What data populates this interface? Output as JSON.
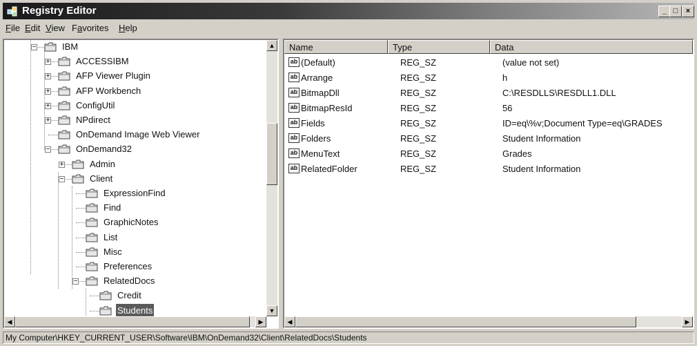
{
  "window": {
    "title": "Registry Editor"
  },
  "menu": [
    "File",
    "Edit",
    "View",
    "Favorites",
    "Help"
  ],
  "menu_underline": [
    "F",
    "E",
    "V",
    "a",
    "H"
  ],
  "tree": [
    {
      "label": "IBM",
      "expander": "−"
    },
    {
      "label": "ACCESSIBM",
      "expander": "+"
    },
    {
      "label": "AFP Viewer Plugin",
      "expander": "+"
    },
    {
      "label": "AFP Workbench",
      "expander": "+"
    },
    {
      "label": "ConfigUtil",
      "expander": "+"
    },
    {
      "label": "NPdirect",
      "expander": "+"
    },
    {
      "label": "OnDemand Image Web Viewer",
      "expander": ""
    },
    {
      "label": "OnDemand32",
      "expander": "−"
    },
    {
      "label": "Admin",
      "expander": "+"
    },
    {
      "label": "Client",
      "expander": "−"
    },
    {
      "label": "ExpressionFind",
      "expander": ""
    },
    {
      "label": "Find",
      "expander": ""
    },
    {
      "label": "GraphicNotes",
      "expander": ""
    },
    {
      "label": "List",
      "expander": ""
    },
    {
      "label": "Misc",
      "expander": ""
    },
    {
      "label": "Preferences",
      "expander": ""
    },
    {
      "label": "RelatedDocs",
      "expander": "−"
    },
    {
      "label": "Credit",
      "expander": ""
    },
    {
      "label": "Students",
      "expander": ""
    }
  ],
  "list": {
    "columns": [
      "Name",
      "Type",
      "Data"
    ],
    "rows": [
      {
        "icon": "ab",
        "name": "(Default)",
        "type": "REG_SZ",
        "data": "(value not set)"
      },
      {
        "icon": "ab",
        "name": "Arrange",
        "type": "REG_SZ",
        "data": "h"
      },
      {
        "icon": "ab",
        "name": "BitmapDll",
        "type": "REG_SZ",
        "data": "C:\\RESDLLS\\RESDLL1.DLL"
      },
      {
        "icon": "ab",
        "name": "BitmapResId",
        "type": "REG_SZ",
        "data": "56"
      },
      {
        "icon": "ab",
        "name": "Fields",
        "type": "REG_SZ",
        "data": "ID=eq\\%v;Document Type=eq\\GRADES"
      },
      {
        "icon": "ab",
        "name": "Folders",
        "type": "REG_SZ",
        "data": "Student Information"
      },
      {
        "icon": "ab",
        "name": "MenuText",
        "type": "REG_SZ",
        "data": "Grades"
      },
      {
        "icon": "ab",
        "name": "RelatedFolder",
        "type": "REG_SZ",
        "data": "Student Information"
      }
    ]
  },
  "status": "My Computer\\HKEY_CURRENT_USER\\Software\\IBM\\OnDemand32\\Client\\RelatedDocs\\Students",
  "caption_buttons": {
    "minimize": "_",
    "maximize": "□",
    "close": "×"
  },
  "scroll_arrows": {
    "up": "▲",
    "down": "▼",
    "left": "◀",
    "right": "▶"
  }
}
